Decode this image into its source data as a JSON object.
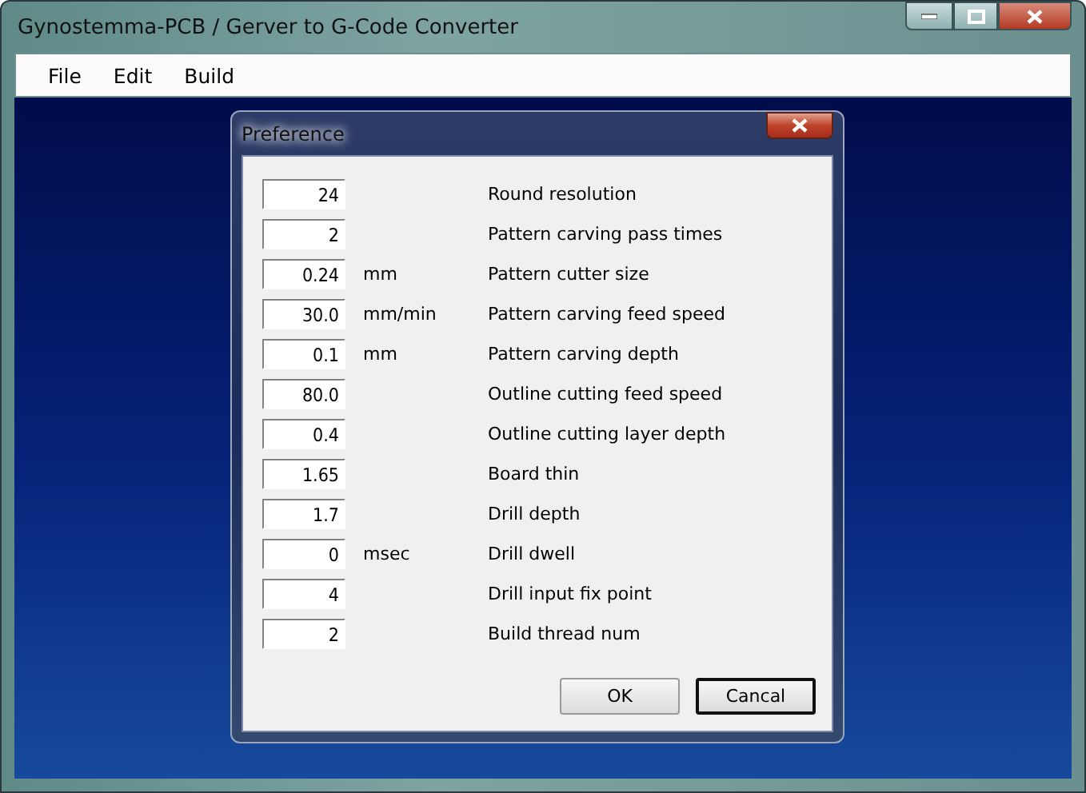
{
  "window": {
    "title": "Gynostemma-PCB / Gerver to G-Code Converter"
  },
  "menu": [
    "File",
    "Edit",
    "Build"
  ],
  "dialog": {
    "title": "Preference",
    "settings": [
      {
        "value": "24",
        "label": "Round resolution"
      },
      {
        "value": "2",
        "label": "Pattern carving pass times"
      },
      {
        "value": "0.24",
        "unit": "mm",
        "label": "Pattern cutter size"
      },
      {
        "value": "30.0",
        "unit": "mm/min",
        "label": "Pattern carving feed speed"
      },
      {
        "value": "0.1",
        "unit": "mm",
        "label": "Pattern carving depth"
      },
      {
        "value": "80.0",
        "label": "Outline cutting feed speed"
      },
      {
        "value": "0.4",
        "label": "Outline cutting layer depth"
      },
      {
        "value": "1.65",
        "label": "Board thin"
      },
      {
        "value": "1.7",
        "label": "Drill depth"
      },
      {
        "value": "0",
        "unit": "msec",
        "label": "Drill dwell"
      },
      {
        "value": "4",
        "label": "Drill input fix point"
      },
      {
        "value": "2",
        "label": "Build thread num"
      }
    ],
    "buttons": [
      {
        "label": "OK",
        "default": false
      },
      {
        "label": "Cancal",
        "default": true
      }
    ]
  }
}
